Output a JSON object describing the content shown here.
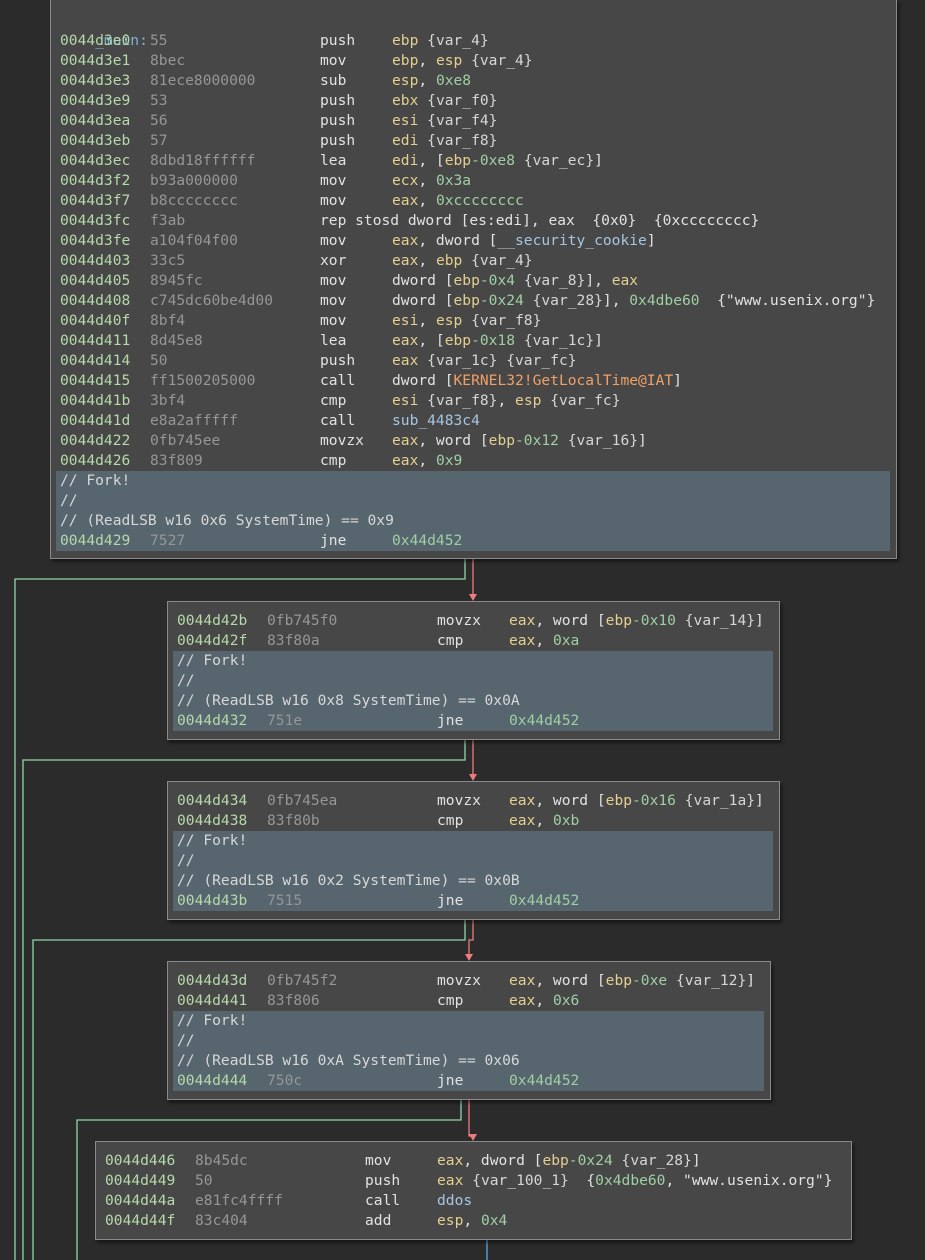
{
  "colors": {
    "background": "#2b2b2b",
    "block_fill": "#474747",
    "highlight_fill": "#56656e",
    "address": "#b5d9a8",
    "register": "#e4cf8f",
    "number": "#9fcfa3",
    "symbol": "#a6c6e0",
    "import": "#f0a066",
    "edge_true": "#8fd6a8",
    "edge_false": "#ee7b7b",
    "edge_uncond": "#5aa9e6"
  },
  "blocks": [
    {
      "label": "_main:",
      "highlight_comments": [
        "// Fork!",
        "//",
        "// (ReadLSB w16 0x6 SystemTime) == 0x9"
      ],
      "instructions": [
        {
          "addr": "0044d3e0",
          "bytes": "55",
          "mnemonic": "push",
          "operand": [
            [
              "r",
              "ebp"
            ],
            [
              "t",
              " "
            ],
            [
              "v",
              "{var_4}"
            ]
          ]
        },
        {
          "addr": "0044d3e1",
          "bytes": "8bec",
          "mnemonic": "mov",
          "operand": [
            [
              "r",
              "ebp"
            ],
            [
              "t",
              ", "
            ],
            [
              "r",
              "esp"
            ],
            [
              "t",
              " "
            ],
            [
              "v",
              "{var_4}"
            ]
          ]
        },
        {
          "addr": "0044d3e3",
          "bytes": "81ece8000000",
          "mnemonic": "sub",
          "operand": [
            [
              "r",
              "esp"
            ],
            [
              "t",
              ", "
            ],
            [
              "n",
              "0xe8"
            ]
          ]
        },
        {
          "addr": "0044d3e9",
          "bytes": "53",
          "mnemonic": "push",
          "operand": [
            [
              "r",
              "ebx"
            ],
            [
              "t",
              " "
            ],
            [
              "v",
              "{var_f0}"
            ]
          ]
        },
        {
          "addr": "0044d3ea",
          "bytes": "56",
          "mnemonic": "push",
          "operand": [
            [
              "r",
              "esi"
            ],
            [
              "t",
              " "
            ],
            [
              "v",
              "{var_f4}"
            ]
          ]
        },
        {
          "addr": "0044d3eb",
          "bytes": "57",
          "mnemonic": "push",
          "operand": [
            [
              "r",
              "edi"
            ],
            [
              "t",
              " "
            ],
            [
              "v",
              "{var_f8}"
            ]
          ]
        },
        {
          "addr": "0044d3ec",
          "bytes": "8dbd18ffffff",
          "mnemonic": "lea",
          "operand": [
            [
              "r",
              "edi"
            ],
            [
              "t",
              ", ["
            ],
            [
              "r",
              "ebp"
            ],
            [
              "n",
              "-0xe8"
            ],
            [
              "t",
              " "
            ],
            [
              "v",
              "{var_ec}"
            ],
            [
              "t",
              "]"
            ]
          ]
        },
        {
          "addr": "0044d3f2",
          "bytes": "b93a000000",
          "mnemonic": "mov",
          "operand": [
            [
              "r",
              "ecx"
            ],
            [
              "t",
              ", "
            ],
            [
              "n",
              "0x3a"
            ]
          ]
        },
        {
          "addr": "0044d3f7",
          "bytes": "b8cccccccc",
          "mnemonic": "mov",
          "operand": [
            [
              "r",
              "eax"
            ],
            [
              "t",
              ", "
            ],
            [
              "n",
              "0xcccccccc"
            ]
          ]
        },
        {
          "addr": "0044d3fc",
          "bytes": "f3ab",
          "mnemonic": "rep stosd dword [es:edi], eax  {0x0}  {0xcccccccc}",
          "operand": []
        },
        {
          "addr": "0044d3fe",
          "bytes": "a104f04f00",
          "mnemonic": "mov",
          "operand": [
            [
              "r",
              "eax"
            ],
            [
              "t",
              ", dword ["
            ],
            [
              "s",
              "__security_cookie"
            ],
            [
              "t",
              "]"
            ]
          ]
        },
        {
          "addr": "0044d403",
          "bytes": "33c5",
          "mnemonic": "xor",
          "operand": [
            [
              "r",
              "eax"
            ],
            [
              "t",
              ", "
            ],
            [
              "r",
              "ebp"
            ],
            [
              "t",
              " "
            ],
            [
              "v",
              "{var_4}"
            ]
          ]
        },
        {
          "addr": "0044d405",
          "bytes": "8945fc",
          "mnemonic": "mov",
          "operand": [
            [
              "t",
              "dword ["
            ],
            [
              "r",
              "ebp"
            ],
            [
              "n",
              "-0x4"
            ],
            [
              "t",
              " "
            ],
            [
              "v",
              "{var_8}"
            ],
            [
              "t",
              "], "
            ],
            [
              "r",
              "eax"
            ]
          ]
        },
        {
          "addr": "0044d408",
          "bytes": "c745dc60be4d00",
          "mnemonic": "mov",
          "operand": [
            [
              "t",
              "dword ["
            ],
            [
              "r",
              "ebp"
            ],
            [
              "n",
              "-0x24"
            ],
            [
              "t",
              " "
            ],
            [
              "v",
              "{var_28}"
            ],
            [
              "t",
              "], "
            ],
            [
              "n",
              "0x4dbe60"
            ],
            [
              "t",
              "  {\"www.usenix.org\"}"
            ]
          ]
        },
        {
          "addr": "0044d40f",
          "bytes": "8bf4",
          "mnemonic": "mov",
          "operand": [
            [
              "r",
              "esi"
            ],
            [
              "t",
              ", "
            ],
            [
              "r",
              "esp"
            ],
            [
              "t",
              " "
            ],
            [
              "v",
              "{var_f8}"
            ]
          ]
        },
        {
          "addr": "0044d411",
          "bytes": "8d45e8",
          "mnemonic": "lea",
          "operand": [
            [
              "r",
              "eax"
            ],
            [
              "t",
              ", ["
            ],
            [
              "r",
              "ebp"
            ],
            [
              "n",
              "-0x18"
            ],
            [
              "t",
              " "
            ],
            [
              "v",
              "{var_1c}"
            ],
            [
              "t",
              "]"
            ]
          ]
        },
        {
          "addr": "0044d414",
          "bytes": "50",
          "mnemonic": "push",
          "operand": [
            [
              "r",
              "eax"
            ],
            [
              "t",
              " "
            ],
            [
              "v",
              "{var_1c} {var_fc}"
            ]
          ]
        },
        {
          "addr": "0044d415",
          "bytes": "ff1500205000",
          "mnemonic": "call",
          "operand": [
            [
              "t",
              "dword ["
            ],
            [
              "i",
              "KERNEL32!GetLocalTime@IAT"
            ],
            [
              "t",
              "]"
            ]
          ]
        },
        {
          "addr": "0044d41b",
          "bytes": "3bf4",
          "mnemonic": "cmp",
          "operand": [
            [
              "r",
              "esi"
            ],
            [
              "t",
              " "
            ],
            [
              "v",
              "{var_f8}"
            ],
            [
              "t",
              ", "
            ],
            [
              "r",
              "esp"
            ],
            [
              "t",
              " "
            ],
            [
              "v",
              "{var_fc}"
            ]
          ]
        },
        {
          "addr": "0044d41d",
          "bytes": "e8a2afffff",
          "mnemonic": "call",
          "operand": [
            [
              "s",
              "sub_4483c4"
            ]
          ]
        },
        {
          "addr": "0044d422",
          "bytes": "0fb745ee",
          "mnemonic": "movzx",
          "operand": [
            [
              "r",
              "eax"
            ],
            [
              "t",
              ", word ["
            ],
            [
              "r",
              "ebp"
            ],
            [
              "n",
              "-0x12"
            ],
            [
              "t",
              " "
            ],
            [
              "v",
              "{var_16}"
            ],
            [
              "t",
              "]"
            ]
          ]
        },
        {
          "addr": "0044d426",
          "bytes": "83f809",
          "mnemonic": "cmp",
          "operand": [
            [
              "r",
              "eax"
            ],
            [
              "t",
              ", "
            ],
            [
              "n",
              "0x9"
            ]
          ]
        }
      ],
      "jump": {
        "addr": "0044d429",
        "bytes": "7527",
        "mnemonic": "jne",
        "operand": [
          [
            "n",
            "0x44d452"
          ]
        ]
      }
    },
    {
      "label": "",
      "highlight_comments": [
        "// Fork!",
        "//",
        "// (ReadLSB w16 0x8 SystemTime) == 0x0A"
      ],
      "instructions": [
        {
          "addr": "0044d42b",
          "bytes": "0fb745f0",
          "mnemonic": "movzx",
          "operand": [
            [
              "r",
              "eax"
            ],
            [
              "t",
              ", word ["
            ],
            [
              "r",
              "ebp"
            ],
            [
              "n",
              "-0x10"
            ],
            [
              "t",
              " "
            ],
            [
              "v",
              "{var_14}"
            ],
            [
              "t",
              "]"
            ]
          ]
        },
        {
          "addr": "0044d42f",
          "bytes": "83f80a",
          "mnemonic": "cmp",
          "operand": [
            [
              "r",
              "eax"
            ],
            [
              "t",
              ", "
            ],
            [
              "n",
              "0xa"
            ]
          ]
        }
      ],
      "jump": {
        "addr": "0044d432",
        "bytes": "751e",
        "mnemonic": "jne",
        "operand": [
          [
            "n",
            "0x44d452"
          ]
        ]
      }
    },
    {
      "label": "",
      "highlight_comments": [
        "// Fork!",
        "//",
        "// (ReadLSB w16 0x2 SystemTime) == 0x0B"
      ],
      "instructions": [
        {
          "addr": "0044d434",
          "bytes": "0fb745ea",
          "mnemonic": "movzx",
          "operand": [
            [
              "r",
              "eax"
            ],
            [
              "t",
              ", word ["
            ],
            [
              "r",
              "ebp"
            ],
            [
              "n",
              "-0x16"
            ],
            [
              "t",
              " "
            ],
            [
              "v",
              "{var_1a}"
            ],
            [
              "t",
              "]"
            ]
          ]
        },
        {
          "addr": "0044d438",
          "bytes": "83f80b",
          "mnemonic": "cmp",
          "operand": [
            [
              "r",
              "eax"
            ],
            [
              "t",
              ", "
            ],
            [
              "n",
              "0xb"
            ]
          ]
        }
      ],
      "jump": {
        "addr": "0044d43b",
        "bytes": "7515",
        "mnemonic": "jne",
        "operand": [
          [
            "n",
            "0x44d452"
          ]
        ]
      }
    },
    {
      "label": "",
      "highlight_comments": [
        "// Fork!",
        "//",
        "// (ReadLSB w16 0xA SystemTime) == 0x06"
      ],
      "instructions": [
        {
          "addr": "0044d43d",
          "bytes": "0fb745f2",
          "mnemonic": "movzx",
          "operand": [
            [
              "r",
              "eax"
            ],
            [
              "t",
              ", word ["
            ],
            [
              "r",
              "ebp"
            ],
            [
              "n",
              "-0xe"
            ],
            [
              "t",
              " "
            ],
            [
              "v",
              "{var_12}"
            ],
            [
              "t",
              "]"
            ]
          ]
        },
        {
          "addr": "0044d441",
          "bytes": "83f806",
          "mnemonic": "cmp",
          "operand": [
            [
              "r",
              "eax"
            ],
            [
              "t",
              ", "
            ],
            [
              "n",
              "0x6"
            ]
          ]
        }
      ],
      "jump": {
        "addr": "0044d444",
        "bytes": "750c",
        "mnemonic": "jne",
        "operand": [
          [
            "n",
            "0x44d452"
          ]
        ]
      }
    },
    {
      "label": "",
      "highlight_comments": [],
      "instructions": [
        {
          "addr": "0044d446",
          "bytes": "8b45dc",
          "mnemonic": "mov",
          "operand": [
            [
              "r",
              "eax"
            ],
            [
              "t",
              ", dword ["
            ],
            [
              "r",
              "ebp"
            ],
            [
              "n",
              "-0x24"
            ],
            [
              "t",
              " "
            ],
            [
              "v",
              "{var_28}"
            ],
            [
              "t",
              "]"
            ]
          ]
        },
        {
          "addr": "0044d449",
          "bytes": "50",
          "mnemonic": "push",
          "operand": [
            [
              "r",
              "eax"
            ],
            [
              "t",
              " "
            ],
            [
              "v",
              "{var_100_1}"
            ],
            [
              "t",
              "  {"
            ],
            [
              "n",
              "0x4dbe60"
            ],
            [
              "t",
              ", \"www.usenix.org\"}"
            ]
          ]
        },
        {
          "addr": "0044d44a",
          "bytes": "e81fc4ffff",
          "mnemonic": "call",
          "operand": [
            [
              "s",
              "ddos"
            ]
          ]
        },
        {
          "addr": "0044d44f",
          "bytes": "83c404",
          "mnemonic": "add",
          "operand": [
            [
              "r",
              "esp"
            ],
            [
              "t",
              ", "
            ],
            [
              "n",
              "0x4"
            ]
          ]
        }
      ],
      "jump": null
    }
  ]
}
